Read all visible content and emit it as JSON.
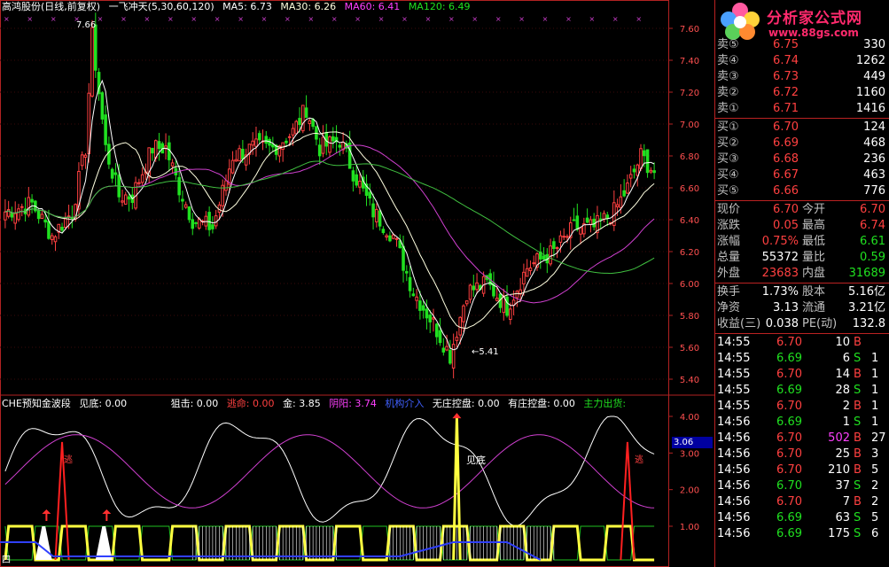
{
  "main_header": {
    "name": "高鸿股份(日线,前复权)",
    "indicator": "一飞冲天(5,30,60,120)",
    "ma5": "MA5: 6.73",
    "ma30": "MA30: 6.26",
    "ma60": "MA60: 6.41",
    "ma120": "MA120: 6.49",
    "high_label": "7.66",
    "low_label": "←5.41"
  },
  "price_axis": [
    "7.60",
    "7.40",
    "7.20",
    "7.00",
    "6.80",
    "6.60",
    "6.40",
    "6.20",
    "6.00",
    "5.80",
    "5.60",
    "5.40"
  ],
  "sub_header": {
    "name": "CHE预知金波段",
    "jiandi": "见底: 0.00",
    "zuji": "狙击: 0.00",
    "taoming": "逃命: 0.00",
    "jin": "金: 3.85",
    "yinyang": "阴阳: 3.74",
    "jigou": "机构介入",
    "wuzhuang": "无庄控盘: 0.00",
    "youzhuang": "有庄控盘: 0.00",
    "zhuli": "主力出货:"
  },
  "sub_axis": [
    "4.00",
    "3.06",
    "3.00",
    "2.00",
    "1.00"
  ],
  "sub_labels": {
    "tao1": "逃",
    "tao2": "逃",
    "jiandi": "见底",
    "bottom_left": "四"
  },
  "logo": {
    "title": "分析家公式网",
    "url": "www.88gs.com"
  },
  "order_book": {
    "sell": [
      {
        "label": "卖⑤",
        "price": "6.75",
        "vol": "330"
      },
      {
        "label": "卖④",
        "price": "6.74",
        "vol": "1262"
      },
      {
        "label": "卖③",
        "price": "6.73",
        "vol": "449"
      },
      {
        "label": "卖②",
        "price": "6.72",
        "vol": "1160"
      },
      {
        "label": "卖①",
        "price": "6.71",
        "vol": "1416"
      }
    ],
    "buy": [
      {
        "label": "买①",
        "price": "6.70",
        "vol": "124"
      },
      {
        "label": "买②",
        "price": "6.69",
        "vol": "468"
      },
      {
        "label": "买③",
        "price": "6.68",
        "vol": "236"
      },
      {
        "label": "买④",
        "price": "6.67",
        "vol": "463"
      },
      {
        "label": "买⑤",
        "price": "6.66",
        "vol": "776"
      }
    ]
  },
  "quote": [
    {
      "l1": "现价",
      "v1": "6.70",
      "c1": "red",
      "l2": "今开",
      "v2": "6.70",
      "c2": "red"
    },
    {
      "l1": "涨跌",
      "v1": "0.05",
      "c1": "red",
      "l2": "最高",
      "v2": "6.74",
      "c2": "red"
    },
    {
      "l1": "涨幅",
      "v1": "0.75%",
      "c1": "red",
      "l2": "最低",
      "v2": "6.61",
      "c2": "green"
    },
    {
      "l1": "总量",
      "v1": "55372",
      "c1": "white",
      "l2": "量比",
      "v2": "0.59",
      "c2": "green"
    },
    {
      "l1": "外盘",
      "v1": "23683",
      "c1": "red",
      "l2": "内盘",
      "v2": "31689",
      "c2": "green"
    }
  ],
  "fund": [
    {
      "l1": "换手",
      "v1": "1.73%",
      "l2": "股本",
      "v2": "5.16亿"
    },
    {
      "l1": "净资",
      "v1": "3.13",
      "l2": "流通",
      "v2": "3.21亿"
    },
    {
      "l1": "收益(三)",
      "v1": "0.038",
      "l2": "PE(动)",
      "v2": "132.8"
    }
  ],
  "ticks": [
    {
      "time": "14:55",
      "price": "6.70",
      "vol": "10",
      "bs": "B",
      "extra": ""
    },
    {
      "time": "14:55",
      "price": "6.69",
      "vol": "6",
      "bs": "S",
      "extra": "1"
    },
    {
      "time": "14:55",
      "price": "6.70",
      "vol": "14",
      "bs": "B",
      "extra": "1"
    },
    {
      "time": "14:55",
      "price": "6.69",
      "vol": "28",
      "bs": "S",
      "extra": "1"
    },
    {
      "time": "14:55",
      "price": "6.70",
      "vol": "2",
      "bs": "B",
      "extra": "1"
    },
    {
      "time": "14:56",
      "price": "6.69",
      "vol": "1",
      "bs": "S",
      "extra": "1"
    },
    {
      "time": "14:56",
      "price": "6.70",
      "vol": "502",
      "bs": "B",
      "extra": "27"
    },
    {
      "time": "14:56",
      "price": "6.70",
      "vol": "25",
      "bs": "B",
      "extra": "3"
    },
    {
      "time": "14:56",
      "price": "6.70",
      "vol": "210",
      "bs": "B",
      "extra": "5"
    },
    {
      "time": "14:56",
      "price": "6.70",
      "vol": "37",
      "bs": "S",
      "extra": "2"
    },
    {
      "time": "14:56",
      "price": "6.70",
      "vol": "7",
      "bs": "B",
      "extra": "2"
    },
    {
      "time": "14:56",
      "price": "6.69",
      "vol": "63",
      "bs": "S",
      "extra": "5"
    },
    {
      "time": "14:56",
      "price": "6.69",
      "vol": "175",
      "bs": "S",
      "extra": "6"
    }
  ],
  "colors": {
    "up": "#ff4040",
    "down": "#20e020",
    "ma5": "#ffffff",
    "ma30": "#ffffe0",
    "ma60": "#d040d0",
    "ma120": "#40c040",
    "grid": "#b22222"
  }
}
